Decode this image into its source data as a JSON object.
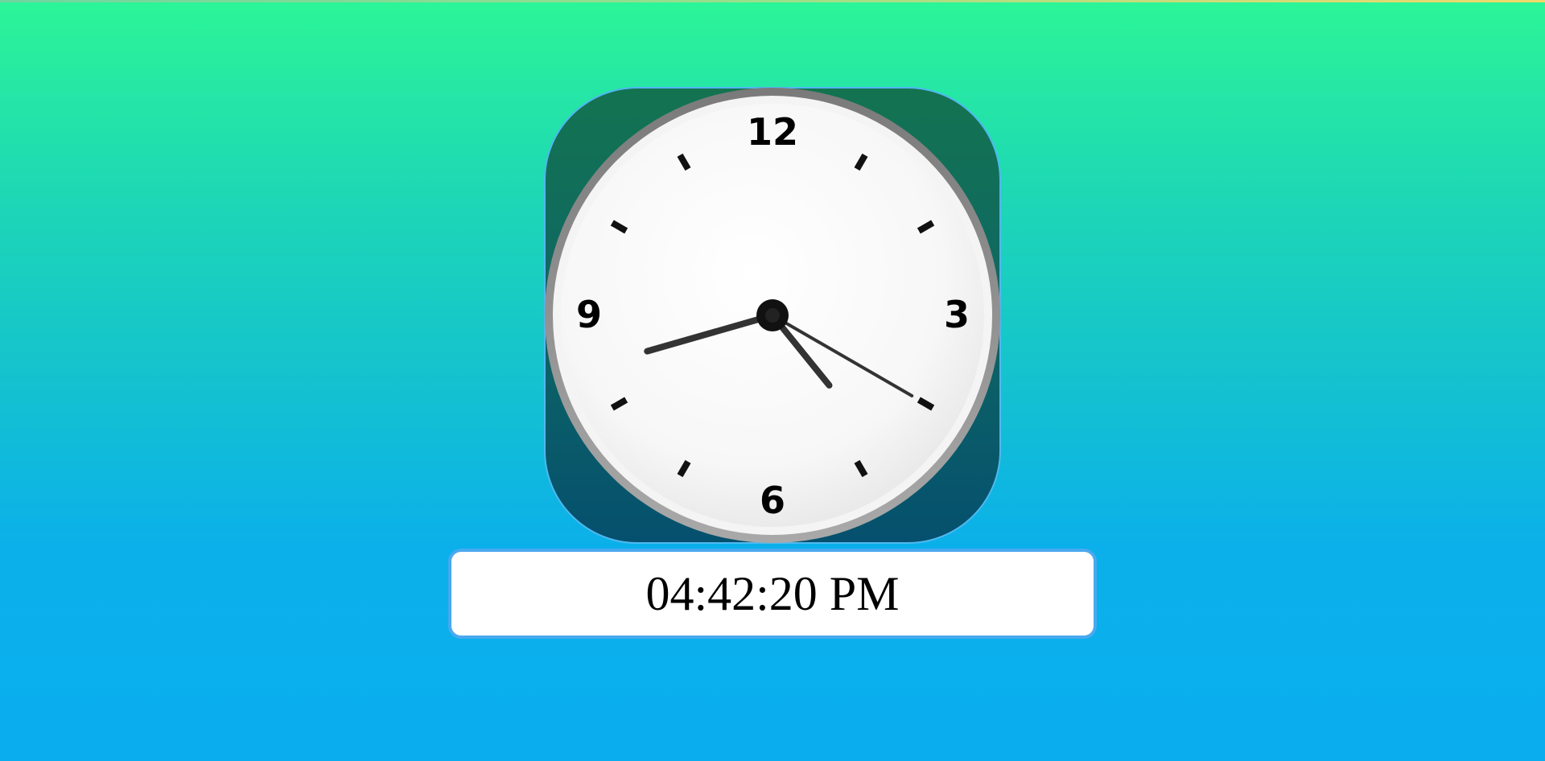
{
  "clock": {
    "numerals": {
      "twelve": "12",
      "three": "3",
      "six": "6",
      "nine": "9"
    },
    "time": {
      "hours": 4,
      "minutes": 42,
      "seconds": 20
    },
    "digital_display": "04:42:20 PM"
  },
  "colors": {
    "background_top": "#2cf597",
    "background_bottom": "#0aaeef",
    "tile_top": "#137350",
    "tile_bottom": "#05506e",
    "hand_color": "#333333",
    "display_border": "#4aa9ef"
  },
  "icons": {
    "clock": "analog-clock-icon"
  }
}
